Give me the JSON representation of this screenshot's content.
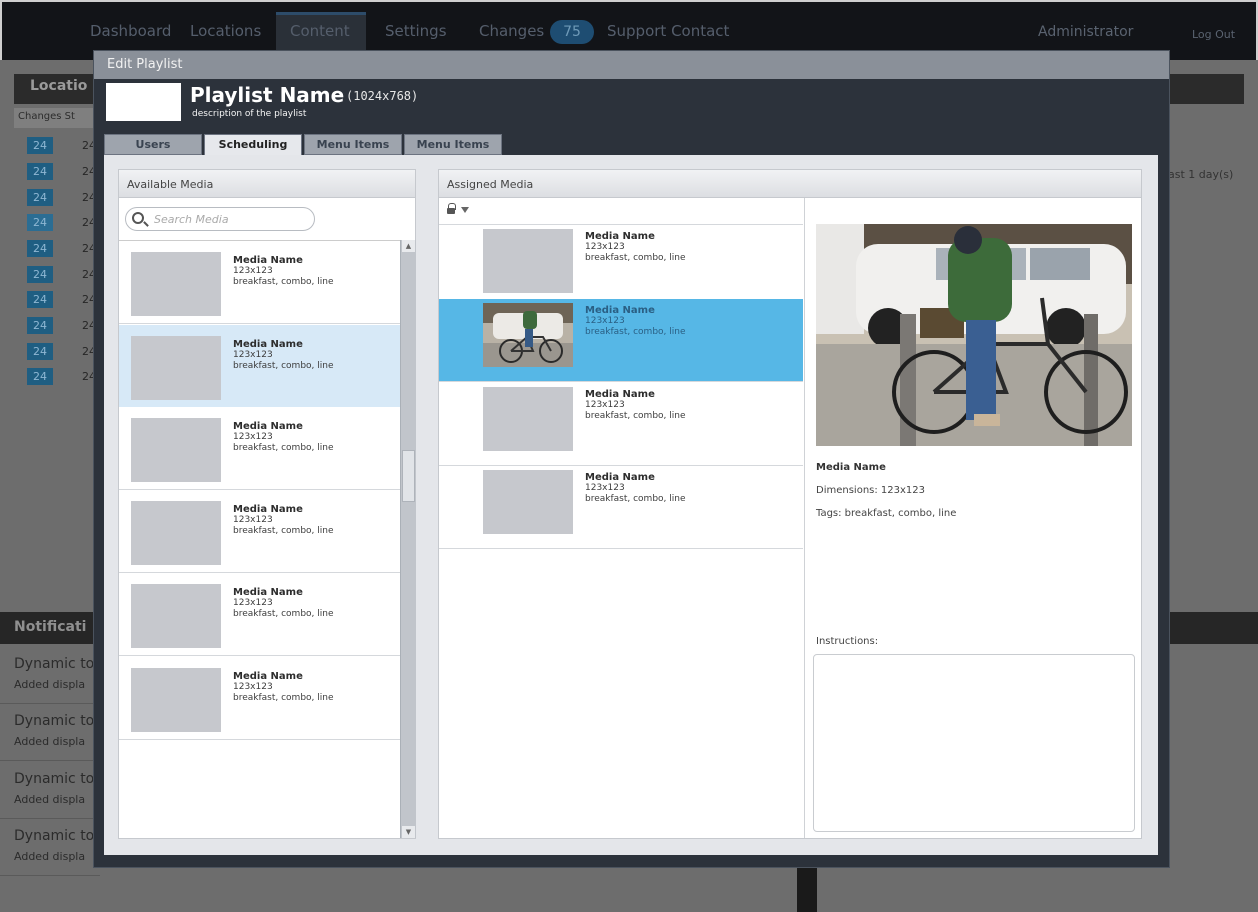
{
  "topnav": {
    "items": [
      "Dashboard",
      "Locations",
      "Content",
      "Settings",
      "Changes",
      "Support Contact"
    ],
    "changes_badge": "75",
    "user": "Administrator",
    "logout": "Log Out"
  },
  "background": {
    "locations_heading": "Locatio",
    "table_header": "Changes  St",
    "row_chips": [
      "24",
      "24",
      "24",
      "24",
      "24",
      "24",
      "24",
      "24",
      "24",
      "24"
    ],
    "row_nums": [
      "24",
      "24",
      "24",
      "24",
      "24",
      "24",
      "24",
      "24",
      "24",
      "24"
    ],
    "days_text": "ast 1 day(s)",
    "notifications_heading": "Notificati",
    "notifications": [
      {
        "title": "Dynamic to",
        "sub": "Added displa"
      },
      {
        "title": "Dynamic to",
        "sub": "Added displa"
      },
      {
        "title": "Dynamic to",
        "sub": "Added displa"
      },
      {
        "title": "Dynamic to",
        "sub": "Added displa"
      }
    ]
  },
  "modal": {
    "title": "Edit Playlist",
    "playlist_name": "Playlist Name",
    "resolution": "(1024x768)",
    "description": "description of the playlist",
    "tabs": [
      "Users",
      "Scheduling",
      "Menu Items",
      "Menu Items"
    ],
    "active_tab": "Scheduling"
  },
  "available": {
    "heading": "Available Media",
    "search_placeholder": "Search Media",
    "items": [
      {
        "name": "Media Name",
        "dim": "123x123",
        "tags": "breakfast, combo, line"
      },
      {
        "name": "Media Name",
        "dim": "123x123",
        "tags": "breakfast, combo, line"
      },
      {
        "name": "Media Name",
        "dim": "123x123",
        "tags": "breakfast, combo, line"
      },
      {
        "name": "Media Name",
        "dim": "123x123",
        "tags": "breakfast, combo, line"
      },
      {
        "name": "Media Name",
        "dim": "123x123",
        "tags": "breakfast, combo, line"
      },
      {
        "name": "Media Name",
        "dim": "123x123",
        "tags": "breakfast, combo, line"
      }
    ],
    "selected_index": 1
  },
  "assigned": {
    "heading": "Assigned Media",
    "items": [
      {
        "name": "Media Name",
        "dim": "123x123",
        "tags": "breakfast, combo, line"
      },
      {
        "name": "Media Name",
        "dim": "123x123",
        "tags": "breakfast, combo, line"
      },
      {
        "name": "Media Name",
        "dim": "123x123",
        "tags": "breakfast, combo, line"
      },
      {
        "name": "Media Name",
        "dim": "123x123",
        "tags": "breakfast, combo, line"
      }
    ],
    "selected_index": 1
  },
  "details": {
    "name": "Media Name",
    "dimensions": "Dimensions: 123x123",
    "tags": "Tags: breakfast, combo, line",
    "instructions_label": "Instructions:",
    "instructions_value": ""
  },
  "colors": {
    "selected_assigned": "#56b7e6",
    "selected_available": "#d7e9f7",
    "modal_bg": "#2c323b",
    "chip": "#1f5e82"
  }
}
